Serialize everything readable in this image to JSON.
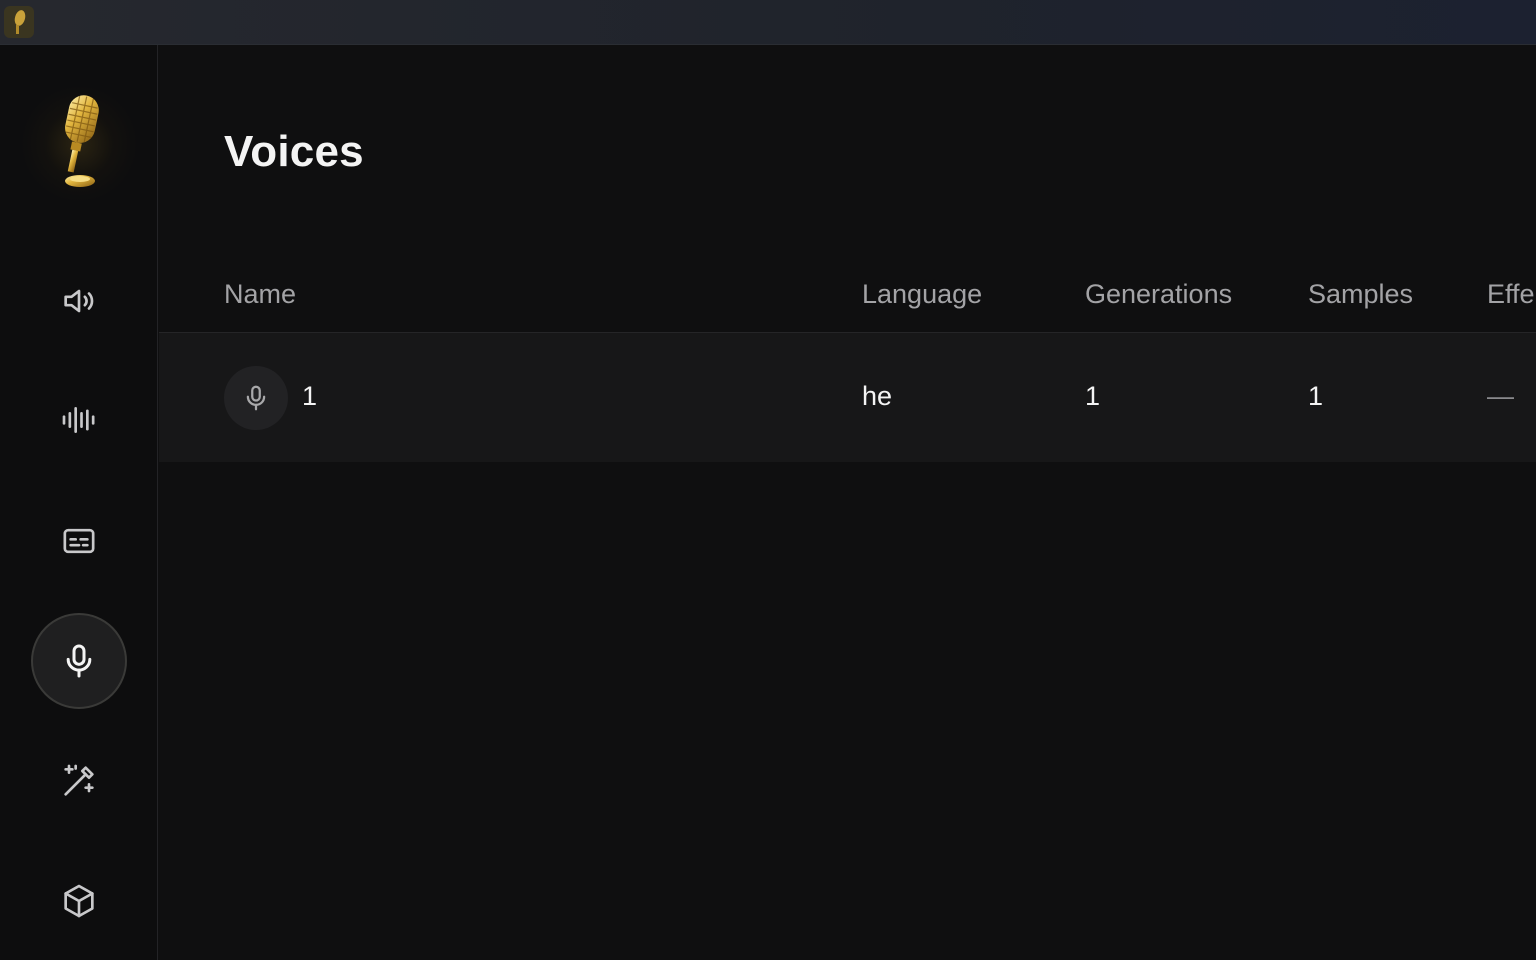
{
  "page": {
    "title": "Voices"
  },
  "sidebar": {
    "items": [
      {
        "name": "speaker-icon"
      },
      {
        "name": "waveform-icon"
      },
      {
        "name": "captions-icon"
      },
      {
        "name": "microphone-icon",
        "active": true
      },
      {
        "name": "magic-wand-icon"
      },
      {
        "name": "box-icon"
      }
    ]
  },
  "table": {
    "columns": [
      "Name",
      "Language",
      "Generations",
      "Samples",
      "Effe"
    ],
    "rows": [
      {
        "name": "1",
        "language": "he",
        "generations": "1",
        "samples": "1",
        "effects": "—"
      }
    ]
  },
  "colors": {
    "background": "#0f0f10",
    "sidebar": "#0d0d0e",
    "row": "#171718",
    "header_text": "#a3a3a6",
    "accent_gold": "#d4a93a"
  }
}
